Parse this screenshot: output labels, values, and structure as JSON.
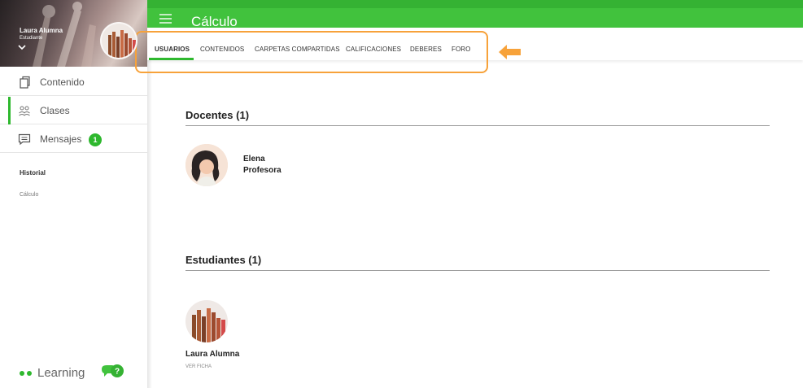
{
  "sidebar": {
    "profile": {
      "name": "Laura Alumna",
      "role": "Estudiante"
    },
    "nav": [
      {
        "label": "Contenido",
        "icon": "copy-icon"
      },
      {
        "label": "Clases",
        "icon": "users-icon",
        "active": true
      },
      {
        "label": "Mensajes",
        "icon": "message-icon",
        "badge": "1"
      }
    ],
    "history": {
      "title": "Historial",
      "items": [
        "Cálculo"
      ]
    },
    "brand": "Learning"
  },
  "header": {
    "title": "Cálculo",
    "tabs": [
      "USUARIOS",
      "CONTENIDOS",
      "CARPETAS COMPARTIDAS",
      "CALIFICACIONES",
      "DEBERES",
      "FORO"
    ],
    "active_tab": "USUARIOS"
  },
  "main": {
    "teachers": {
      "title": "Docentes (1)",
      "people": [
        {
          "name": "Elena",
          "role": "Profesora"
        }
      ]
    },
    "students": {
      "title": "Estudiantes (1)",
      "people": [
        {
          "name": "Laura Alumna",
          "action": "VER FICHA"
        }
      ]
    }
  },
  "colors": {
    "accent": "#41c23d",
    "highlight": "#f7a23a"
  }
}
